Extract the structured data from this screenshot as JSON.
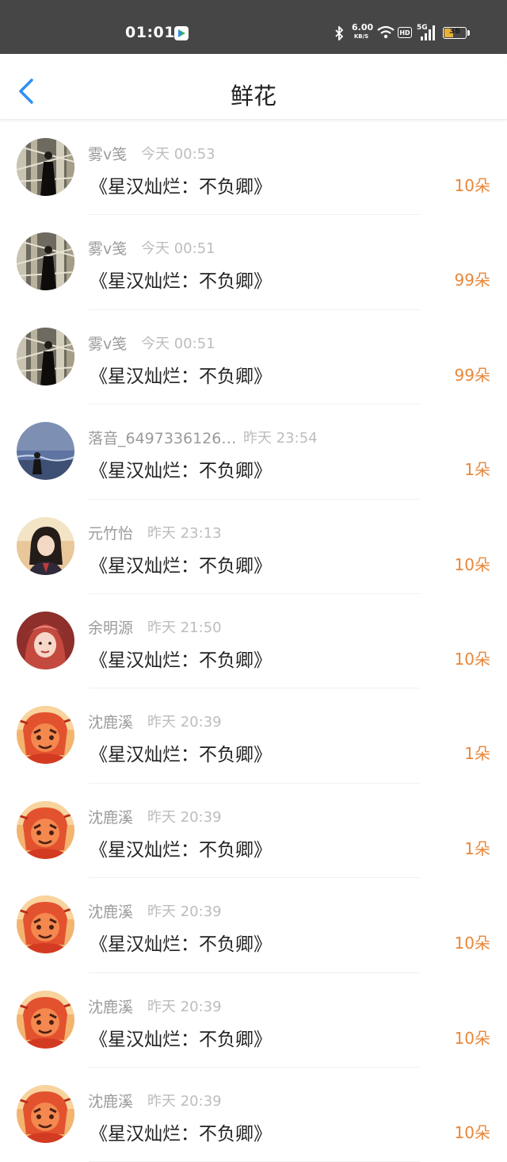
{
  "status_bar": {
    "time": "01:01",
    "speed_value": "6.00",
    "speed_unit": "KB/S",
    "hd": "HD",
    "network": "5G",
    "battery": "38",
    "icons": [
      "app-icon",
      "bluetooth-icon",
      "wifi-icon",
      "signal-icon",
      "battery-icon"
    ]
  },
  "nav": {
    "title": "鲜花",
    "back_icon": "chevron-left-icon"
  },
  "colors": {
    "accent": "#2e8ff0",
    "count": "#e8873a",
    "name": "#9b9b9b",
    "time": "#bdbdbd",
    "statusbar": "#464646"
  },
  "items": [
    {
      "name": "雾v笺",
      "time": "今天 00:53",
      "book": "《星汉灿烂：不负卿》",
      "count": "10朵",
      "avatar": "forest"
    },
    {
      "name": "雾v笺",
      "time": "今天 00:51",
      "book": "《星汉灿烂：不负卿》",
      "count": "99朵",
      "avatar": "forest"
    },
    {
      "name": "雾v笺",
      "time": "今天 00:51",
      "book": "《星汉灿烂：不负卿》",
      "count": "99朵",
      "avatar": "forest"
    },
    {
      "name": "落音_6497336126…",
      "time": "昨天 23:54",
      "book": "《星汉灿烂：不负卿》",
      "count": "1朵",
      "avatar": "sea"
    },
    {
      "name": "元竹怡",
      "time": "昨天 23:13",
      "book": "《星汉灿烂：不负卿》",
      "count": "10朵",
      "avatar": "girl"
    },
    {
      "name": "余明源",
      "time": "昨天 21:50",
      "book": "《星汉灿烂：不负卿》",
      "count": "10朵",
      "avatar": "red"
    },
    {
      "name": "沈鹿溪",
      "time": "昨天 20:39",
      "book": "《星汉灿烂：不负卿》",
      "count": "1朵",
      "avatar": "cartoon"
    },
    {
      "name": "沈鹿溪",
      "time": "昨天 20:39",
      "book": "《星汉灿烂：不负卿》",
      "count": "1朵",
      "avatar": "cartoon"
    },
    {
      "name": "沈鹿溪",
      "time": "昨天 20:39",
      "book": "《星汉灿烂：不负卿》",
      "count": "10朵",
      "avatar": "cartoon"
    },
    {
      "name": "沈鹿溪",
      "time": "昨天 20:39",
      "book": "《星汉灿烂：不负卿》",
      "count": "10朵",
      "avatar": "cartoon"
    },
    {
      "name": "沈鹿溪",
      "time": "昨天 20:39",
      "book": "《星汉灿烂：不负卿》",
      "count": "10朵",
      "avatar": "cartoon"
    }
  ]
}
